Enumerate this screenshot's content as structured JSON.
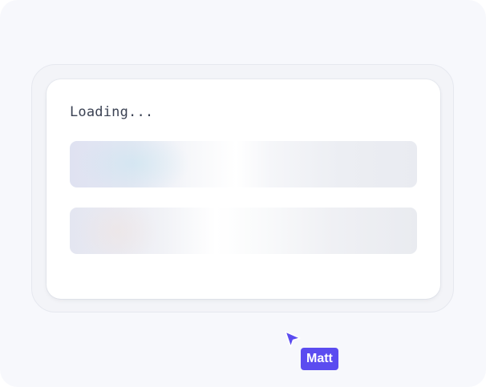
{
  "loader": {
    "text": "Loading..."
  },
  "skeleton": {
    "bar_count": 2
  },
  "collaborator": {
    "name": "Matt",
    "color": "#5b4cf0",
    "icon": "cursor-arrow-icon"
  },
  "colors": {
    "background": "#f7f8fc",
    "card": "#ffffff",
    "skeleton_base": "#eceef3",
    "text": "#3b4253"
  }
}
